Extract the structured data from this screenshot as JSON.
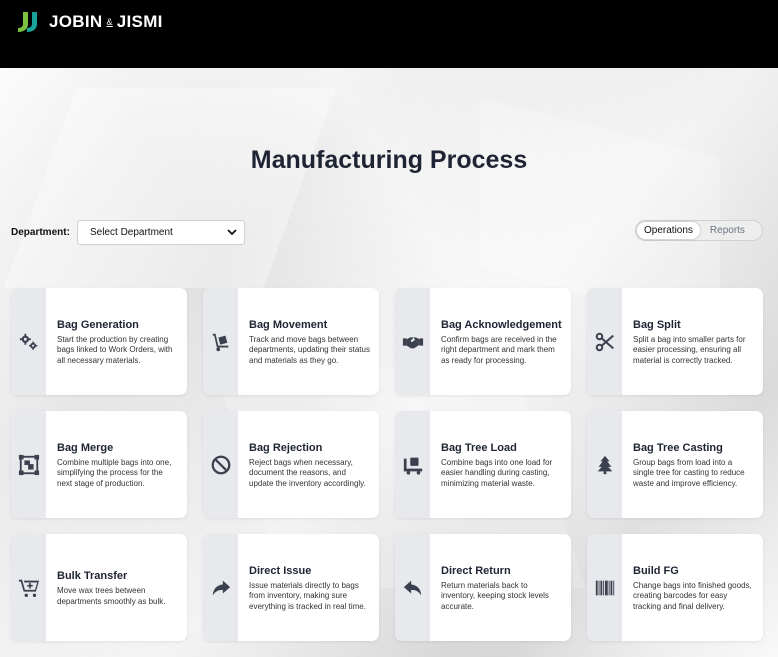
{
  "brand": {
    "name_left": "JOBIN",
    "amp": "&",
    "name_right": "JISMI"
  },
  "page": {
    "title": "Manufacturing Process"
  },
  "filter": {
    "label": "Department:",
    "placeholder": "Select Department"
  },
  "toggle": {
    "operations": "Operations",
    "reports": "Reports",
    "active": "Operations"
  },
  "cards": [
    {
      "title": "Bag Generation",
      "desc": "Start the production by creating bags linked to Work Orders, with all necessary materials.",
      "icon": "gears-icon"
    },
    {
      "title": "Bag Movement",
      "desc": "Track and move bags between departments, updating their status and materials as they go.",
      "icon": "hand-truck-icon"
    },
    {
      "title": "Bag Acknowledgement",
      "desc": "Confirm bags are received in the right department and mark them as ready for processing.",
      "icon": "handshake-icon"
    },
    {
      "title": "Bag Split",
      "desc": "Split a bag into smaller parts for easier processing, ensuring all material is correctly tracked.",
      "icon": "scissors-icon"
    },
    {
      "title": "Bag Merge",
      "desc": "Combine multiple bags into one, simplifying the process for the next stage of production.",
      "icon": "object-group-icon"
    },
    {
      "title": "Bag Rejection",
      "desc": "Reject bags when necessary, document the reasons, and update the inventory accordingly.",
      "icon": "ban-icon"
    },
    {
      "title": "Bag Tree Load",
      "desc": "Combine bags into one load for easier handling during casting, minimizing material waste.",
      "icon": "dolly-icon"
    },
    {
      "title": "Bag Tree Casting",
      "desc": "Group bags from load into a single tree for casting to reduce waste and improve efficiency.",
      "icon": "tree-icon"
    },
    {
      "title": "Bulk Transfer",
      "desc": "Move wax trees between departments smoothly as bulk.",
      "icon": "cart-plus-icon"
    },
    {
      "title": "Direct Issue",
      "desc": "Issue materials directly to bags from inventory, making sure everything is tracked in real time.",
      "icon": "share-arrow-icon"
    },
    {
      "title": "Direct Return",
      "desc": "Return materials back to inventory, keeping stock levels accurate.",
      "icon": "reply-arrow-icon"
    },
    {
      "title": "Build FG",
      "desc": "Change bags into finished goods, creating barcodes for easy tracking and final delivery.",
      "icon": "barcode-icon"
    }
  ],
  "colors": {
    "topbar": "#000000",
    "logo_green": "#7cc242",
    "logo_teal": "#1aa39a",
    "text_dark": "#1e2433",
    "rail": "#e8e9ec",
    "icon": "#3c4150"
  }
}
